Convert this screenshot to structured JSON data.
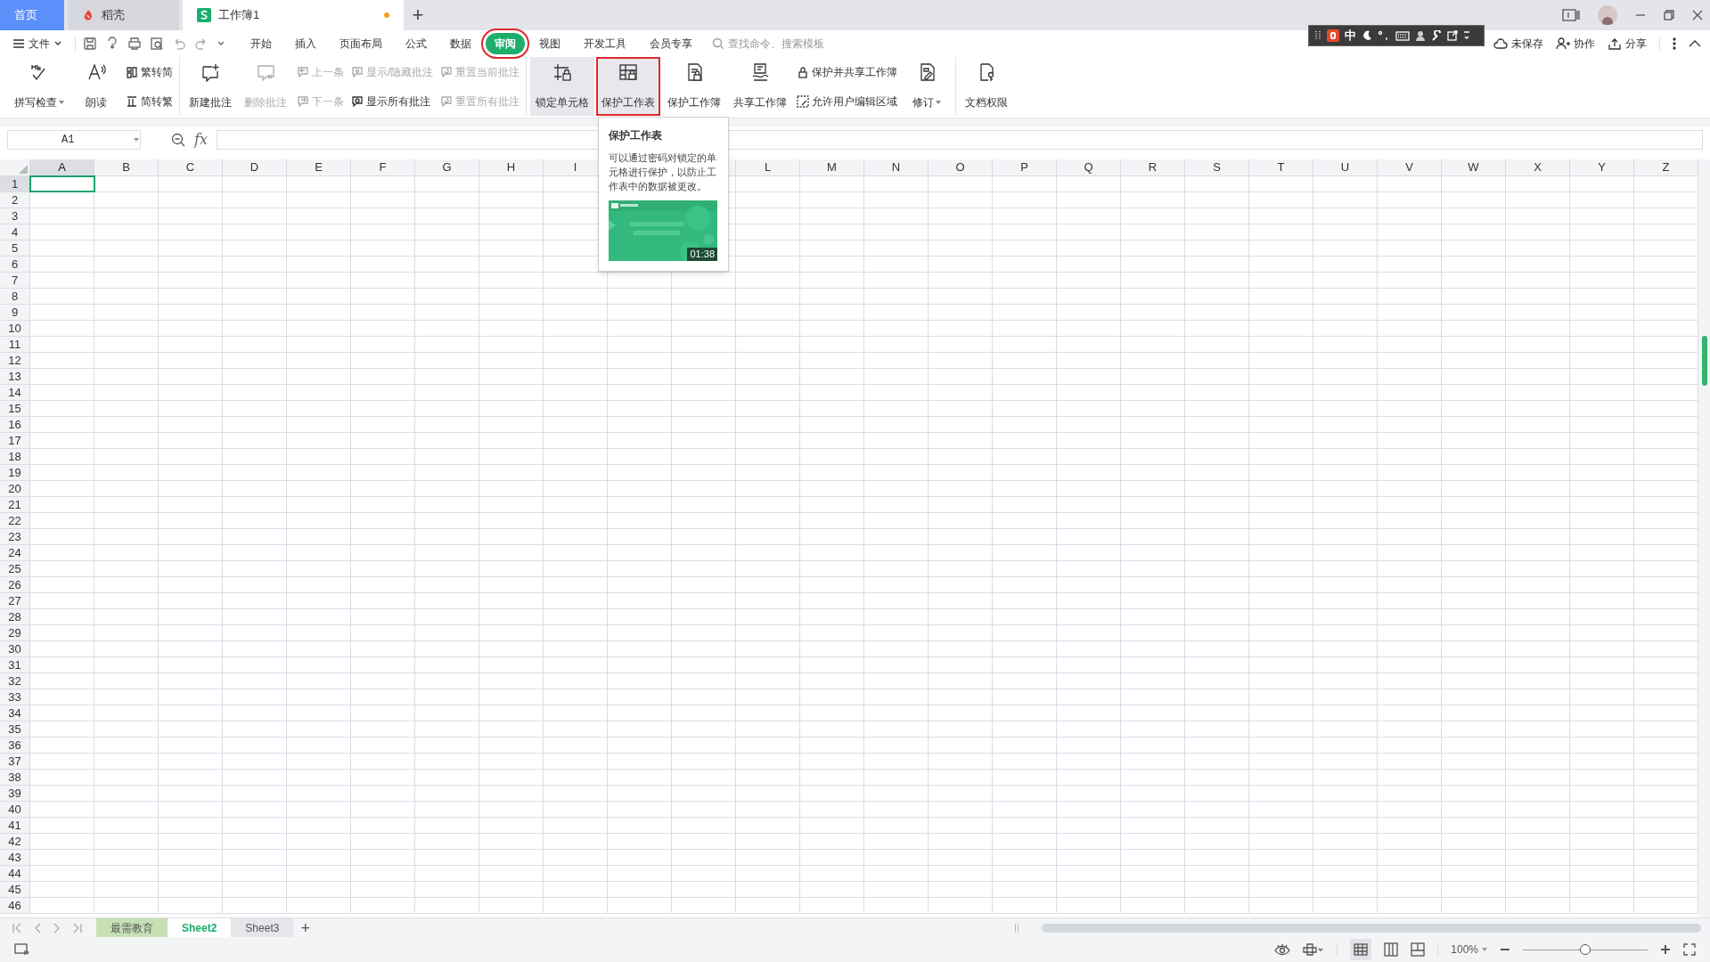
{
  "tabs": [
    {
      "label": "首页",
      "kind": "home",
      "selected": false
    },
    {
      "label": "稻壳",
      "kind": "docer",
      "selected": false
    },
    {
      "label": "工作簿1",
      "kind": "sheet",
      "selected": true,
      "unsaved": true
    }
  ],
  "new_tab": "+",
  "file_menu": "文件",
  "menu": [
    {
      "label": "开始",
      "selected": false,
      "highlighted": false
    },
    {
      "label": "插入",
      "selected": false,
      "highlighted": false
    },
    {
      "label": "页面布局",
      "selected": false,
      "highlighted": false
    },
    {
      "label": "公式",
      "selected": false,
      "highlighted": false
    },
    {
      "label": "数据",
      "selected": false,
      "highlighted": false
    },
    {
      "label": "审阅",
      "selected": true,
      "highlighted": true
    },
    {
      "label": "视图",
      "selected": false,
      "highlighted": false
    },
    {
      "label": "开发工具",
      "selected": false,
      "highlighted": false
    },
    {
      "label": "会员专享",
      "selected": false,
      "highlighted": false
    }
  ],
  "search": {
    "placeholder": "查找命令、搜索模板"
  },
  "ime_bar": {
    "mode": "中"
  },
  "actions": [
    "未保存",
    "协作",
    "分享"
  ],
  "ribbon": [
    {
      "items": [
        {
          "kind": "big",
          "label": "拼写检查",
          "dropdown": true,
          "disabled": false,
          "active": false,
          "highlighted": false
        },
        {
          "kind": "big",
          "label": "朗读",
          "dropdown": false,
          "disabled": false,
          "active": false,
          "highlighted": false
        },
        {
          "kind": "pair",
          "top": {
            "label": "繁转简",
            "disabled": false
          },
          "bottom": {
            "label": "简转繁",
            "disabled": false
          }
        }
      ]
    },
    {
      "items": [
        {
          "kind": "big",
          "label": "新建批注",
          "dropdown": false,
          "disabled": false,
          "active": false,
          "highlighted": false
        },
        {
          "kind": "big",
          "label": "删除批注",
          "dropdown": false,
          "disabled": true,
          "active": false,
          "highlighted": false
        },
        {
          "kind": "pair",
          "top": {
            "label": "上一条",
            "disabled": true
          },
          "bottom": {
            "label": "下一条",
            "disabled": true
          }
        },
        {
          "kind": "pair",
          "top": {
            "label": "显示/隐藏批注",
            "disabled": true
          },
          "bottom": {
            "label": "显示所有批注",
            "disabled": false
          }
        },
        {
          "kind": "pair",
          "top": {
            "label": "重置当前批注",
            "disabled": true
          },
          "bottom": {
            "label": "重置所有批注",
            "disabled": true
          }
        }
      ]
    },
    {
      "items": [
        {
          "kind": "big",
          "label": "锁定单元格",
          "dropdown": false,
          "disabled": false,
          "active": true,
          "highlighted": false
        },
        {
          "kind": "big",
          "label": "保护工作表",
          "dropdown": false,
          "disabled": false,
          "active": true,
          "highlighted": true
        },
        {
          "kind": "big",
          "label": "保护工作簿",
          "dropdown": false,
          "disabled": false,
          "active": false,
          "highlighted": false
        },
        {
          "kind": "big",
          "label": "共享工作簿",
          "dropdown": false,
          "disabled": false,
          "active": false,
          "highlighted": false
        },
        {
          "kind": "pair",
          "top": {
            "label": "保护并共享工作簿",
            "disabled": false
          },
          "bottom": {
            "label": "允许用户编辑区域",
            "disabled": false
          }
        },
        {
          "kind": "big",
          "label": "修订",
          "dropdown": true,
          "disabled": false,
          "active": false,
          "highlighted": false
        }
      ]
    },
    {
      "items": [
        {
          "kind": "big",
          "label": "文档权限",
          "dropdown": false,
          "disabled": false,
          "active": false,
          "highlighted": false
        }
      ]
    }
  ],
  "name_box": "A1",
  "formula_label": "fx",
  "columns": [
    {
      "label": "A",
      "selected": true
    },
    {
      "label": "B",
      "selected": false
    },
    {
      "label": "C",
      "selected": false
    },
    {
      "label": "D",
      "selected": false
    },
    {
      "label": "E",
      "selected": false
    },
    {
      "label": "F",
      "selected": false
    },
    {
      "label": "G",
      "selected": false
    },
    {
      "label": "H",
      "selected": false
    },
    {
      "label": "I",
      "selected": false
    },
    {},
    {},
    {
      "label": "L",
      "selected": false
    },
    {
      "label": "M",
      "selected": false
    },
    {
      "label": "N",
      "selected": false
    },
    {
      "label": "O",
      "selected": false
    },
    {
      "label": "P",
      "selected": false
    },
    {
      "label": "Q",
      "selected": false
    },
    {
      "label": "R",
      "selected": false
    },
    {
      "label": "S",
      "selected": false
    },
    {
      "label": "T",
      "selected": false
    },
    {
      "label": "U",
      "selected": false
    },
    {
      "label": "V",
      "selected": false
    },
    {
      "label": "W",
      "selected": false
    },
    {
      "label": "X",
      "selected": false
    },
    {
      "label": "Y",
      "selected": false
    },
    {
      "label": "Z",
      "selected": false
    }
  ],
  "rows": [
    {
      "label": "1",
      "selected": true
    },
    {
      "label": "2",
      "selected": false
    },
    {
      "label": "3",
      "selected": false
    },
    {
      "label": "4",
      "selected": false
    },
    {
      "label": "5",
      "selected": false
    },
    {
      "label": "6",
      "selected": false
    },
    {
      "label": "7",
      "selected": false
    },
    {
      "label": "8",
      "selected": false
    },
    {
      "label": "9",
      "selected": false
    },
    {
      "label": "10",
      "selected": false
    },
    {
      "label": "11",
      "selected": false
    },
    {
      "label": "12",
      "selected": false
    },
    {
      "label": "13",
      "selected": false
    },
    {
      "label": "14",
      "selected": false
    },
    {
      "label": "15",
      "selected": false
    },
    {
      "label": "16",
      "selected": false
    },
    {
      "label": "17",
      "selected": false
    },
    {
      "label": "18",
      "selected": false
    },
    {
      "label": "19",
      "selected": false
    },
    {
      "label": "20",
      "selected": false
    },
    {
      "label": "21",
      "selected": false
    },
    {
      "label": "22",
      "selected": false
    },
    {
      "label": "23",
      "selected": false
    },
    {
      "label": "24",
      "selected": false
    },
    {
      "label": "25",
      "selected": false
    },
    {
      "label": "26",
      "selected": false
    },
    {
      "label": "27",
      "selected": false
    },
    {
      "label": "28",
      "selected": false
    },
    {
      "label": "29",
      "selected": false
    },
    {
      "label": "30",
      "selected": false
    },
    {
      "label": "31",
      "selected": false
    },
    {
      "label": "32",
      "selected": false
    },
    {
      "label": "33",
      "selected": false
    },
    {
      "label": "34",
      "selected": false
    },
    {
      "label": "35",
      "selected": false
    },
    {
      "label": "36",
      "selected": false
    },
    {
      "label": "37",
      "selected": false
    },
    {
      "label": "38",
      "selected": false
    },
    {
      "label": "39",
      "selected": false
    },
    {
      "label": "40",
      "selected": false
    },
    {
      "label": "41",
      "selected": false
    },
    {
      "label": "42",
      "selected": false
    },
    {
      "label": "43",
      "selected": false
    },
    {
      "label": "44",
      "selected": false
    },
    {
      "label": "45",
      "selected": false
    },
    {
      "label": "46",
      "selected": false
    }
  ],
  "tooltip": {
    "title": "保护工作表",
    "body": "可以通过密码对锁定的单元格进行保护，以防止工作表中的数据被更改。",
    "video": {
      "kind": "picture",
      "duration": "01:38"
    }
  },
  "sheet_tabs": [
    {
      "label": "最需教育",
      "selected": false,
      "color": "#c6e0b4"
    },
    {
      "label": "Sheet2",
      "selected": true
    },
    {
      "label": "Sheet3",
      "selected": false
    }
  ],
  "add_sheet": "+",
  "status_bar": {
    "zoom": "100%",
    "zoom_slider": {
      "level": 0.5
    }
  }
}
